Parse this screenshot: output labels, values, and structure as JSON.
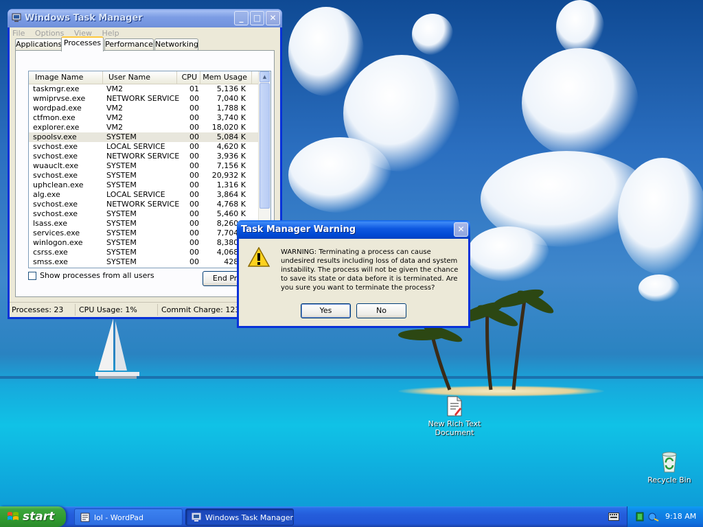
{
  "desktop": {
    "icons": [
      {
        "label": "New Rich Text Document"
      },
      {
        "label": "Recycle Bin"
      }
    ]
  },
  "task_manager": {
    "title": "Windows Task Manager",
    "menu": [
      "File",
      "Options",
      "View",
      "Help"
    ],
    "tabs": [
      "Applications",
      "Processes",
      "Performance",
      "Networking"
    ],
    "active_tab": "Processes",
    "columns": [
      "Image Name",
      "User Name",
      "CPU",
      "Mem Usage"
    ],
    "processes": [
      {
        "name": "taskmgr.exe",
        "user": "VM2",
        "cpu": "01",
        "mem": "5,136 K"
      },
      {
        "name": "wmiprvse.exe",
        "user": "NETWORK SERVICE",
        "cpu": "00",
        "mem": "7,040 K"
      },
      {
        "name": "wordpad.exe",
        "user": "VM2",
        "cpu": "00",
        "mem": "1,788 K"
      },
      {
        "name": "ctfmon.exe",
        "user": "VM2",
        "cpu": "00",
        "mem": "3,740 K"
      },
      {
        "name": "explorer.exe",
        "user": "VM2",
        "cpu": "00",
        "mem": "18,020 K"
      },
      {
        "name": "spoolsv.exe",
        "user": "SYSTEM",
        "cpu": "00",
        "mem": "5,084 K"
      },
      {
        "name": "svchost.exe",
        "user": "LOCAL SERVICE",
        "cpu": "00",
        "mem": "4,620 K"
      },
      {
        "name": "svchost.exe",
        "user": "NETWORK SERVICE",
        "cpu": "00",
        "mem": "3,936 K"
      },
      {
        "name": "wuauclt.exe",
        "user": "SYSTEM",
        "cpu": "00",
        "mem": "7,156 K"
      },
      {
        "name": "svchost.exe",
        "user": "SYSTEM",
        "cpu": "00",
        "mem": "20,932 K"
      },
      {
        "name": "uphclean.exe",
        "user": "SYSTEM",
        "cpu": "00",
        "mem": "1,316 K"
      },
      {
        "name": "alg.exe",
        "user": "LOCAL SERVICE",
        "cpu": "00",
        "mem": "3,864 K"
      },
      {
        "name": "svchost.exe",
        "user": "NETWORK SERVICE",
        "cpu": "00",
        "mem": "4,768 K"
      },
      {
        "name": "svchost.exe",
        "user": "SYSTEM",
        "cpu": "00",
        "mem": "5,460 K"
      },
      {
        "name": "lsass.exe",
        "user": "SYSTEM",
        "cpu": "00",
        "mem": "8,260 K"
      },
      {
        "name": "services.exe",
        "user": "SYSTEM",
        "cpu": "00",
        "mem": "7,704 K"
      },
      {
        "name": "winlogon.exe",
        "user": "SYSTEM",
        "cpu": "00",
        "mem": "8,380 K"
      },
      {
        "name": "csrss.exe",
        "user": "SYSTEM",
        "cpu": "00",
        "mem": "4,068 K"
      },
      {
        "name": "smss.exe",
        "user": "SYSTEM",
        "cpu": "00",
        "mem": "428 K"
      }
    ],
    "selected_process": "spoolsv.exe",
    "show_all_label": "Show processes from all users",
    "show_all_checked": false,
    "end_process_label": "End Process",
    "status": {
      "processes": "Processes: 23",
      "cpu": "CPU Usage: 1%",
      "commit": "Commit Charge: 123M / 1246M"
    }
  },
  "warning_dialog": {
    "title": "Task Manager Warning",
    "message": "WARNING: Terminating a process can cause undesired results including loss of data and system instability. The process will not be given the chance to save its state or data before it is terminated.  Are you sure you want to terminate the process?",
    "yes_label": "Yes",
    "no_label": "No"
  },
  "taskbar": {
    "start_label": "start",
    "buttons": [
      {
        "label": "lol - WordPad",
        "active": false
      },
      {
        "label": "Windows Task Manager",
        "active": true
      }
    ],
    "clock": "9:18 AM"
  },
  "colors": {
    "title_active": "#0a5fe8",
    "window_face": "#ece9d8",
    "start_green": "#3ca53c",
    "taskbar_blue": "#245ddb"
  }
}
